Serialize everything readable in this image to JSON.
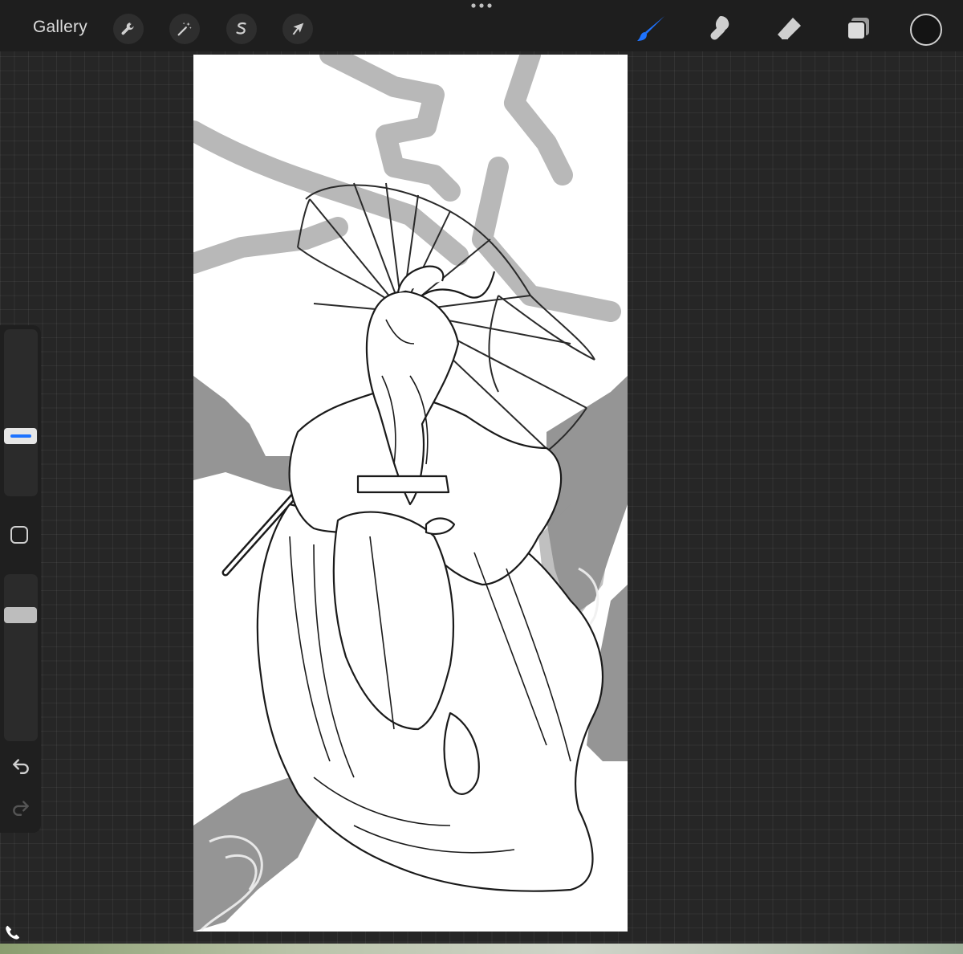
{
  "toolbar": {
    "gallery_label": "Gallery",
    "actions_icon": "wrench-icon",
    "adjustments_icon": "magic-wand-icon",
    "selection_icon": "selection-s-icon",
    "transform_icon": "arrow-cursor-icon",
    "brush_icon": "brush-icon",
    "smudge_icon": "smudge-icon",
    "eraser_icon": "eraser-icon",
    "layers_icon": "layers-icon",
    "active_tool": "brush",
    "accent_color": "#1e73ff",
    "current_color": "#141414"
  },
  "sidebar": {
    "undo_icon": "undo-icon",
    "redo_icon": "redo-icon",
    "modify_icon": "square-icon"
  },
  "footer": {
    "quick_icon": "phone-icon"
  }
}
